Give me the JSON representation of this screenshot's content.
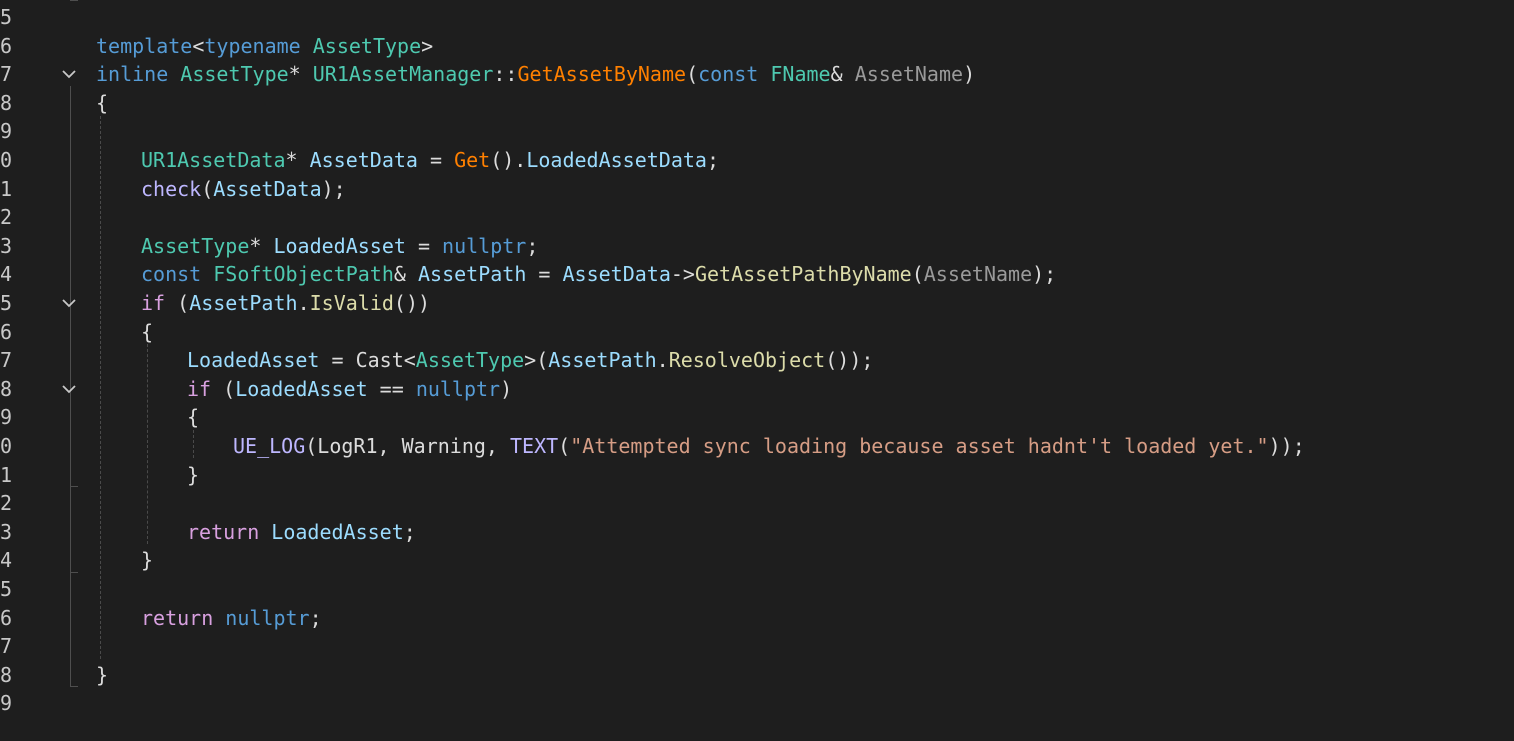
{
  "editor": {
    "language": "cpp",
    "theme_colors": {
      "background": "#1e1e1e",
      "keyword": "#569cd6",
      "control": "#d8a0df",
      "type": "#4ec9b0",
      "function": "#dcdcaa",
      "member_function": "#ff8000",
      "variable": "#9cdcfe",
      "parameter": "#9a9a9a",
      "string": "#d69d85",
      "macro": "#beb7ff",
      "plain": "#dcdcdc"
    },
    "lines": [
      {
        "number": "5",
        "fold": false,
        "indent": 0,
        "tokens": []
      },
      {
        "number": "6",
        "fold": false,
        "indent": 1,
        "tokens": [
          {
            "t": "template",
            "c": "kw"
          },
          {
            "t": "<",
            "c": "pl"
          },
          {
            "t": "typename",
            "c": "kw"
          },
          {
            "t": " ",
            "c": "pl"
          },
          {
            "t": "AssetType",
            "c": "ty"
          },
          {
            "t": ">",
            "c": "pl"
          }
        ]
      },
      {
        "number": "7",
        "fold": true,
        "indent": 1,
        "tokens": [
          {
            "t": "inline",
            "c": "kw"
          },
          {
            "t": " ",
            "c": "pl"
          },
          {
            "t": "AssetType",
            "c": "ty"
          },
          {
            "t": "* ",
            "c": "pl"
          },
          {
            "t": "UR1AssetManager",
            "c": "ty"
          },
          {
            "t": "::",
            "c": "pl"
          },
          {
            "t": "GetAssetByName",
            "c": "fnm"
          },
          {
            "t": "(",
            "c": "pl"
          },
          {
            "t": "const",
            "c": "kw"
          },
          {
            "t": " ",
            "c": "pl"
          },
          {
            "t": "FName",
            "c": "ty"
          },
          {
            "t": "& ",
            "c": "pl"
          },
          {
            "t": "AssetName",
            "c": "prm"
          },
          {
            "t": ")",
            "c": "pl"
          }
        ]
      },
      {
        "number": "8",
        "fold": false,
        "indent": 1,
        "tokens": [
          {
            "t": "{",
            "c": "pl"
          }
        ]
      },
      {
        "number": "9",
        "fold": false,
        "indent": 0,
        "tokens": []
      },
      {
        "number": "0",
        "fold": false,
        "indent": 2,
        "tokens": [
          {
            "t": "UR1AssetData",
            "c": "ty"
          },
          {
            "t": "* ",
            "c": "pl"
          },
          {
            "t": "AssetData",
            "c": "id"
          },
          {
            "t": " = ",
            "c": "pl"
          },
          {
            "t": "Get",
            "c": "fnm"
          },
          {
            "t": "().",
            "c": "pl"
          },
          {
            "t": "LoadedAssetData",
            "c": "id"
          },
          {
            "t": ";",
            "c": "pl"
          }
        ]
      },
      {
        "number": "1",
        "fold": false,
        "indent": 2,
        "tokens": [
          {
            "t": "check",
            "c": "mac"
          },
          {
            "t": "(",
            "c": "pl"
          },
          {
            "t": "AssetData",
            "c": "id"
          },
          {
            "t": ");",
            "c": "pl"
          }
        ]
      },
      {
        "number": "2",
        "fold": false,
        "indent": 0,
        "tokens": []
      },
      {
        "number": "3",
        "fold": false,
        "indent": 2,
        "tokens": [
          {
            "t": "AssetType",
            "c": "ty"
          },
          {
            "t": "* ",
            "c": "pl"
          },
          {
            "t": "LoadedAsset",
            "c": "id"
          },
          {
            "t": " = ",
            "c": "pl"
          },
          {
            "t": "nullptr",
            "c": "kw"
          },
          {
            "t": ";",
            "c": "pl"
          }
        ]
      },
      {
        "number": "4",
        "fold": false,
        "indent": 2,
        "tokens": [
          {
            "t": "const",
            "c": "kw"
          },
          {
            "t": " ",
            "c": "pl"
          },
          {
            "t": "FSoftObjectPath",
            "c": "ty"
          },
          {
            "t": "& ",
            "c": "pl"
          },
          {
            "t": "AssetPath",
            "c": "id"
          },
          {
            "t": " = ",
            "c": "pl"
          },
          {
            "t": "AssetData",
            "c": "id"
          },
          {
            "t": "->",
            "c": "pl"
          },
          {
            "t": "GetAssetPathByName",
            "c": "fn"
          },
          {
            "t": "(",
            "c": "pl"
          },
          {
            "t": "AssetName",
            "c": "prm"
          },
          {
            "t": ");",
            "c": "pl"
          }
        ]
      },
      {
        "number": "5",
        "fold": true,
        "indent": 2,
        "tokens": [
          {
            "t": "if",
            "c": "ctl"
          },
          {
            "t": " (",
            "c": "pl"
          },
          {
            "t": "AssetPath",
            "c": "id"
          },
          {
            "t": ".",
            "c": "pl"
          },
          {
            "t": "IsValid",
            "c": "fn"
          },
          {
            "t": "())",
            "c": "pl"
          }
        ]
      },
      {
        "number": "6",
        "fold": false,
        "indent": 2,
        "tokens": [
          {
            "t": "{",
            "c": "pl"
          }
        ]
      },
      {
        "number": "7",
        "fold": false,
        "indent": 3,
        "tokens": [
          {
            "t": "LoadedAsset",
            "c": "id"
          },
          {
            "t": " = ",
            "c": "pl"
          },
          {
            "t": "Cast",
            "c": "pl"
          },
          {
            "t": "<",
            "c": "pl"
          },
          {
            "t": "AssetType",
            "c": "ty"
          },
          {
            "t": ">(",
            "c": "pl"
          },
          {
            "t": "AssetPath",
            "c": "id"
          },
          {
            "t": ".",
            "c": "pl"
          },
          {
            "t": "ResolveObject",
            "c": "fn"
          },
          {
            "t": "());",
            "c": "pl"
          }
        ]
      },
      {
        "number": "8",
        "fold": true,
        "indent": 3,
        "tokens": [
          {
            "t": "if",
            "c": "ctl"
          },
          {
            "t": " (",
            "c": "pl"
          },
          {
            "t": "LoadedAsset",
            "c": "id"
          },
          {
            "t": " == ",
            "c": "pl"
          },
          {
            "t": "nullptr",
            "c": "kw"
          },
          {
            "t": ")",
            "c": "pl"
          }
        ]
      },
      {
        "number": "9",
        "fold": false,
        "indent": 3,
        "tokens": [
          {
            "t": "{",
            "c": "pl"
          }
        ]
      },
      {
        "number": "0",
        "fold": false,
        "indent": 4,
        "tokens": [
          {
            "t": "UE_LOG",
            "c": "mac"
          },
          {
            "t": "(",
            "c": "pl"
          },
          {
            "t": "LogR1",
            "c": "pl"
          },
          {
            "t": ", ",
            "c": "pl"
          },
          {
            "t": "Warning",
            "c": "pl"
          },
          {
            "t": ", ",
            "c": "pl"
          },
          {
            "t": "TEXT",
            "c": "mac"
          },
          {
            "t": "(",
            "c": "pl"
          },
          {
            "t": "\"Attempted sync loading because asset hadnt't loaded yet.\"",
            "c": "str"
          },
          {
            "t": "));",
            "c": "pl"
          }
        ]
      },
      {
        "number": "1",
        "fold": false,
        "indent": 3,
        "tokens": [
          {
            "t": "}",
            "c": "pl"
          }
        ]
      },
      {
        "number": "2",
        "fold": false,
        "indent": 0,
        "tokens": []
      },
      {
        "number": "3",
        "fold": false,
        "indent": 3,
        "tokens": [
          {
            "t": "return",
            "c": "ctl"
          },
          {
            "t": " ",
            "c": "pl"
          },
          {
            "t": "LoadedAsset",
            "c": "id"
          },
          {
            "t": ";",
            "c": "pl"
          }
        ]
      },
      {
        "number": "4",
        "fold": false,
        "indent": 2,
        "tokens": [
          {
            "t": "}",
            "c": "pl"
          }
        ]
      },
      {
        "number": "5",
        "fold": false,
        "indent": 0,
        "tokens": []
      },
      {
        "number": "6",
        "fold": false,
        "indent": 2,
        "tokens": [
          {
            "t": "return",
            "c": "ctl"
          },
          {
            "t": " ",
            "c": "pl"
          },
          {
            "t": "nullptr",
            "c": "kw"
          },
          {
            "t": ";",
            "c": "pl"
          }
        ]
      },
      {
        "number": "7",
        "fold": false,
        "indent": 0,
        "tokens": []
      },
      {
        "number": "8",
        "fold": false,
        "indent": 1,
        "tokens": [
          {
            "t": "}",
            "c": "pl"
          }
        ]
      },
      {
        "number": "9",
        "fold": false,
        "indent": 0,
        "tokens": []
      }
    ]
  }
}
